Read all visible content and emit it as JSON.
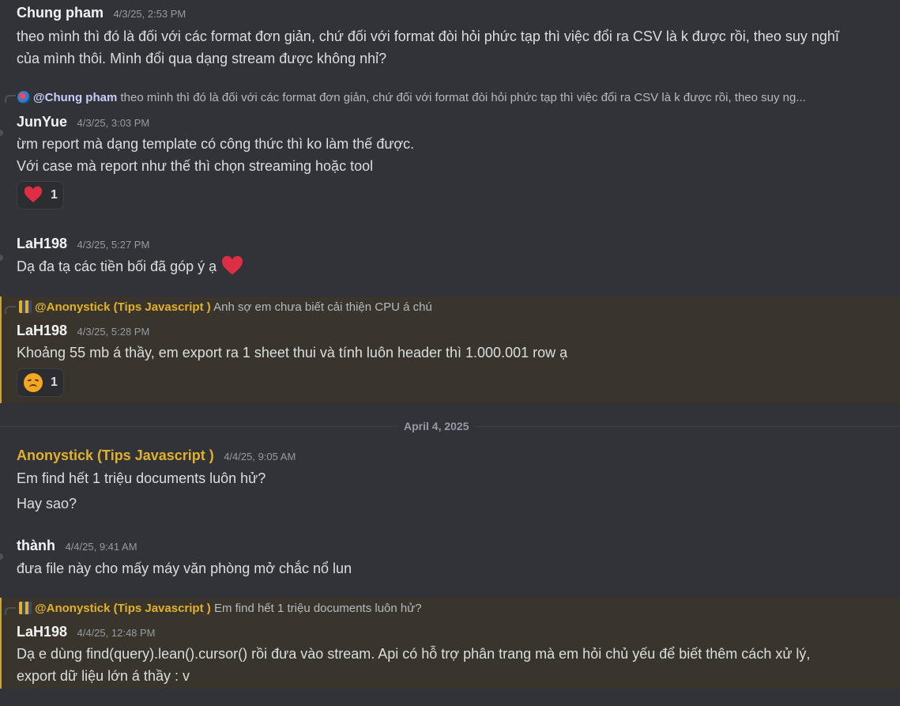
{
  "messages": {
    "m1": {
      "author": "Chung pham",
      "time": "4/3/25, 2:53 PM",
      "line1": "theo mình thì đó là đối với các format đơn giản, chứ đối với format đòi hỏi phức tạp thì việc đổi ra CSV là k được rồi, theo suy nghĩ",
      "line2": "của mình thôi. Mình đổi qua dạng stream được không nhỉ?"
    },
    "m2": {
      "reply_mention": "@Chung pham",
      "reply_text": "theo mình thì đó là đối với các format đơn giản, chứ đối với format đòi hỏi phức tạp thì việc đổi ra CSV là k được rồi, theo suy ng...",
      "author": "JunYue",
      "time": "4/3/25, 3:03 PM",
      "line1": "ừm report mà dạng template có công thức thì ko làm thế được.",
      "line2": "Với case mà report như thế thì chọn streaming hoặc tool",
      "reaction_icon": "heart",
      "reaction_count": "1"
    },
    "m3": {
      "author": "LaH198",
      "time": "4/3/25, 5:27 PM",
      "line1": "Dạ đa tạ các tiền bối đã góp ý ạ"
    },
    "m4": {
      "reply_mention": "@Anonystick (Tips Javascript )",
      "reply_text": "Anh sợ em chưa biết cải thiện CPU á chú",
      "author": "LaH198",
      "time": "4/3/25, 5:28 PM",
      "line1": "Khoảng 55 mb á thầy, em export ra 1 sheet thui và tính luôn header thì 1.000.001 row ạ",
      "reaction_icon": "disappointed-face",
      "reaction_count": "1"
    },
    "m5": {
      "author": "Anonystick (Tips Javascript )",
      "time": "4/4/25, 9:05 AM",
      "line1": "Em find hết 1 triệu documents luôn hử?",
      "line2": "Hay sao?"
    },
    "m6": {
      "author": "thành",
      "time": "4/4/25, 9:41 AM",
      "line1": "đưa file này cho mấy máy văn phòng mở chắc nổ lun"
    },
    "m7": {
      "reply_mention": "@Anonystick (Tips Javascript )",
      "reply_text": "Em find hết 1 triệu documents luôn hử?",
      "author": "LaH198",
      "time": "4/4/25, 12:48 PM",
      "line1": "Dạ e dùng find(query).lean().cursor() rồi đưa vào stream. Api có hỗ trợ phân trang mà em hỏi chủ yếu để biết thêm cách xử lý,",
      "line2": "export dữ liệu lớn á thầy : v"
    }
  },
  "date_divider": "April 4, 2025",
  "colors": {
    "background": "#313338",
    "highlight": "#3a352c",
    "gold_name": "#e1b12c",
    "mention": "#c9cdfb"
  }
}
